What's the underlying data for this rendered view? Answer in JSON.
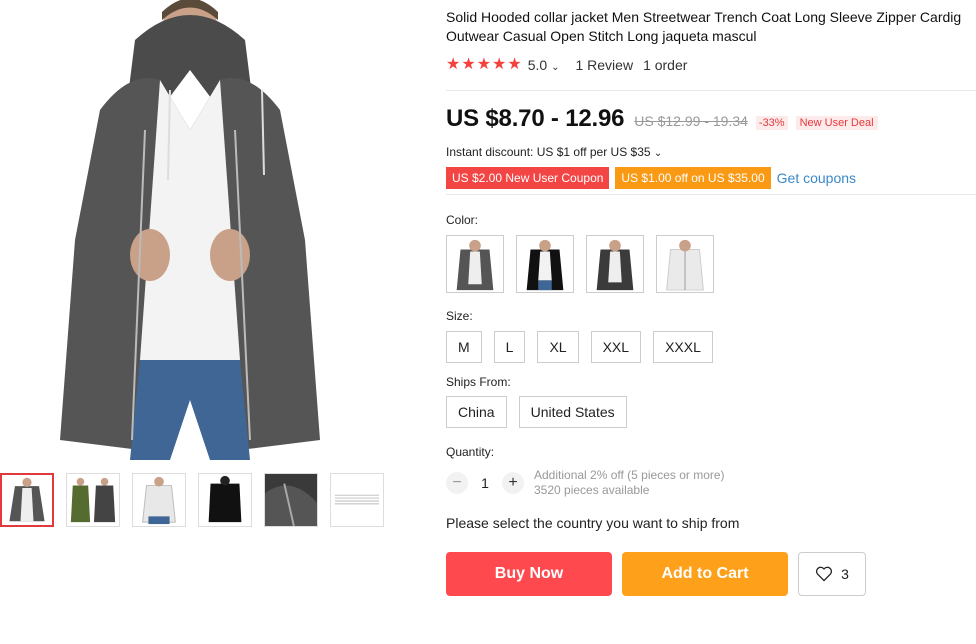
{
  "product": {
    "title": "Solid Hooded collar jacket Men Streetwear Trench Coat Long Sleeve Zipper Cardig…",
    "title_line1": "Solid Hooded collar jacket Men Streetwear Trench Coat Long Sleeve Zipper Cardig",
    "title_line2": "Outwear Casual Open Stitch Long jaqueta mascul",
    "rating": "5.0",
    "rating_stars": 5,
    "reviews": "1 Review",
    "orders": "1 order"
  },
  "price": {
    "current": "US $8.70 - 12.96",
    "original": "US $12.99 - 19.34",
    "discount": "-33%",
    "deal": "New User Deal"
  },
  "instant_discount": "Instant discount: US $1 off per US $35",
  "coupons": {
    "new_user": "US $2.00 New User Coupon",
    "off": "US $1.00 off on US $35.00",
    "link": "Get coupons"
  },
  "color": {
    "label": "Color:",
    "options": [
      "dark-gray",
      "black",
      "charcoal",
      "white"
    ]
  },
  "size": {
    "label": "Size:",
    "options": [
      "M",
      "L",
      "XL",
      "XXL",
      "XXXL"
    ]
  },
  "ships_from": {
    "label": "Ships From:",
    "options": [
      "China",
      "United States"
    ]
  },
  "quantity": {
    "label": "Quantity:",
    "minus": "−",
    "value": "1",
    "plus": "+",
    "note1": "Additional 2% off (5 pieces or more)",
    "note2": "3520 pieces available"
  },
  "ship_msg": "Please select the country you want to ship from",
  "actions": {
    "buy": "Buy Now",
    "cart": "Add to Cart",
    "wish_count": "3"
  },
  "colors": {
    "accent": "#e4393c",
    "buy": "#fe4a4f",
    "cart": "#fea01a",
    "link": "#3a89c9"
  }
}
